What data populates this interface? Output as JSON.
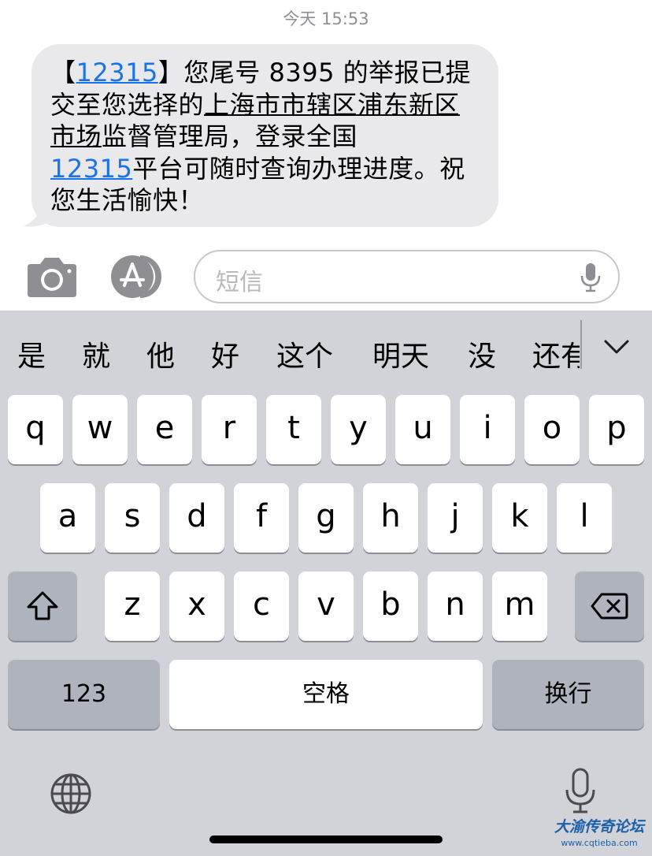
{
  "header": {
    "timestamp": "今天 15:53"
  },
  "message": {
    "segments": [
      {
        "id": "s1",
        "text": "【"
      },
      {
        "id": "s2",
        "text": "12315"
      },
      {
        "id": "s3",
        "text": "】您尾号 8395 的举报已提交至您选择的"
      },
      {
        "id": "s4",
        "text": "上海市市辖区浦东新区市场"
      },
      {
        "id": "s5",
        "text": "监督管理局，登录全国"
      },
      {
        "id": "s6",
        "text": "12315"
      },
      {
        "id": "s7",
        "text": "平台可随时查询办理进度。祝您生活愉快！"
      }
    ]
  },
  "input": {
    "placeholder": "短信"
  },
  "candidates": [
    "是",
    "就",
    "他",
    "好",
    "这个",
    "明天",
    "没",
    "还有"
  ],
  "keyboard": {
    "row1": [
      "q",
      "w",
      "e",
      "r",
      "t",
      "y",
      "u",
      "i",
      "o",
      "p"
    ],
    "row2": [
      "a",
      "s",
      "d",
      "f",
      "g",
      "h",
      "j",
      "k",
      "l"
    ],
    "row3": [
      "z",
      "x",
      "c",
      "v",
      "b",
      "n",
      "m"
    ],
    "numbers_label": "123",
    "space_label": "空格",
    "return_label": "换行"
  },
  "icons": {
    "camera": "camera-icon",
    "apps": "app-store-icon",
    "mic": "microphone-icon",
    "shift": "shift-icon",
    "delete": "delete-icon",
    "globe": "globe-icon",
    "chevron": "chevron-down-icon"
  },
  "watermark": {
    "title": "大渝传奇论坛",
    "url": "www.cqtieba.com"
  },
  "colors": {
    "bubble": "#e9e9eb",
    "link": "#1a73e8",
    "keyboard_bg": "#d1d3d9"
  }
}
